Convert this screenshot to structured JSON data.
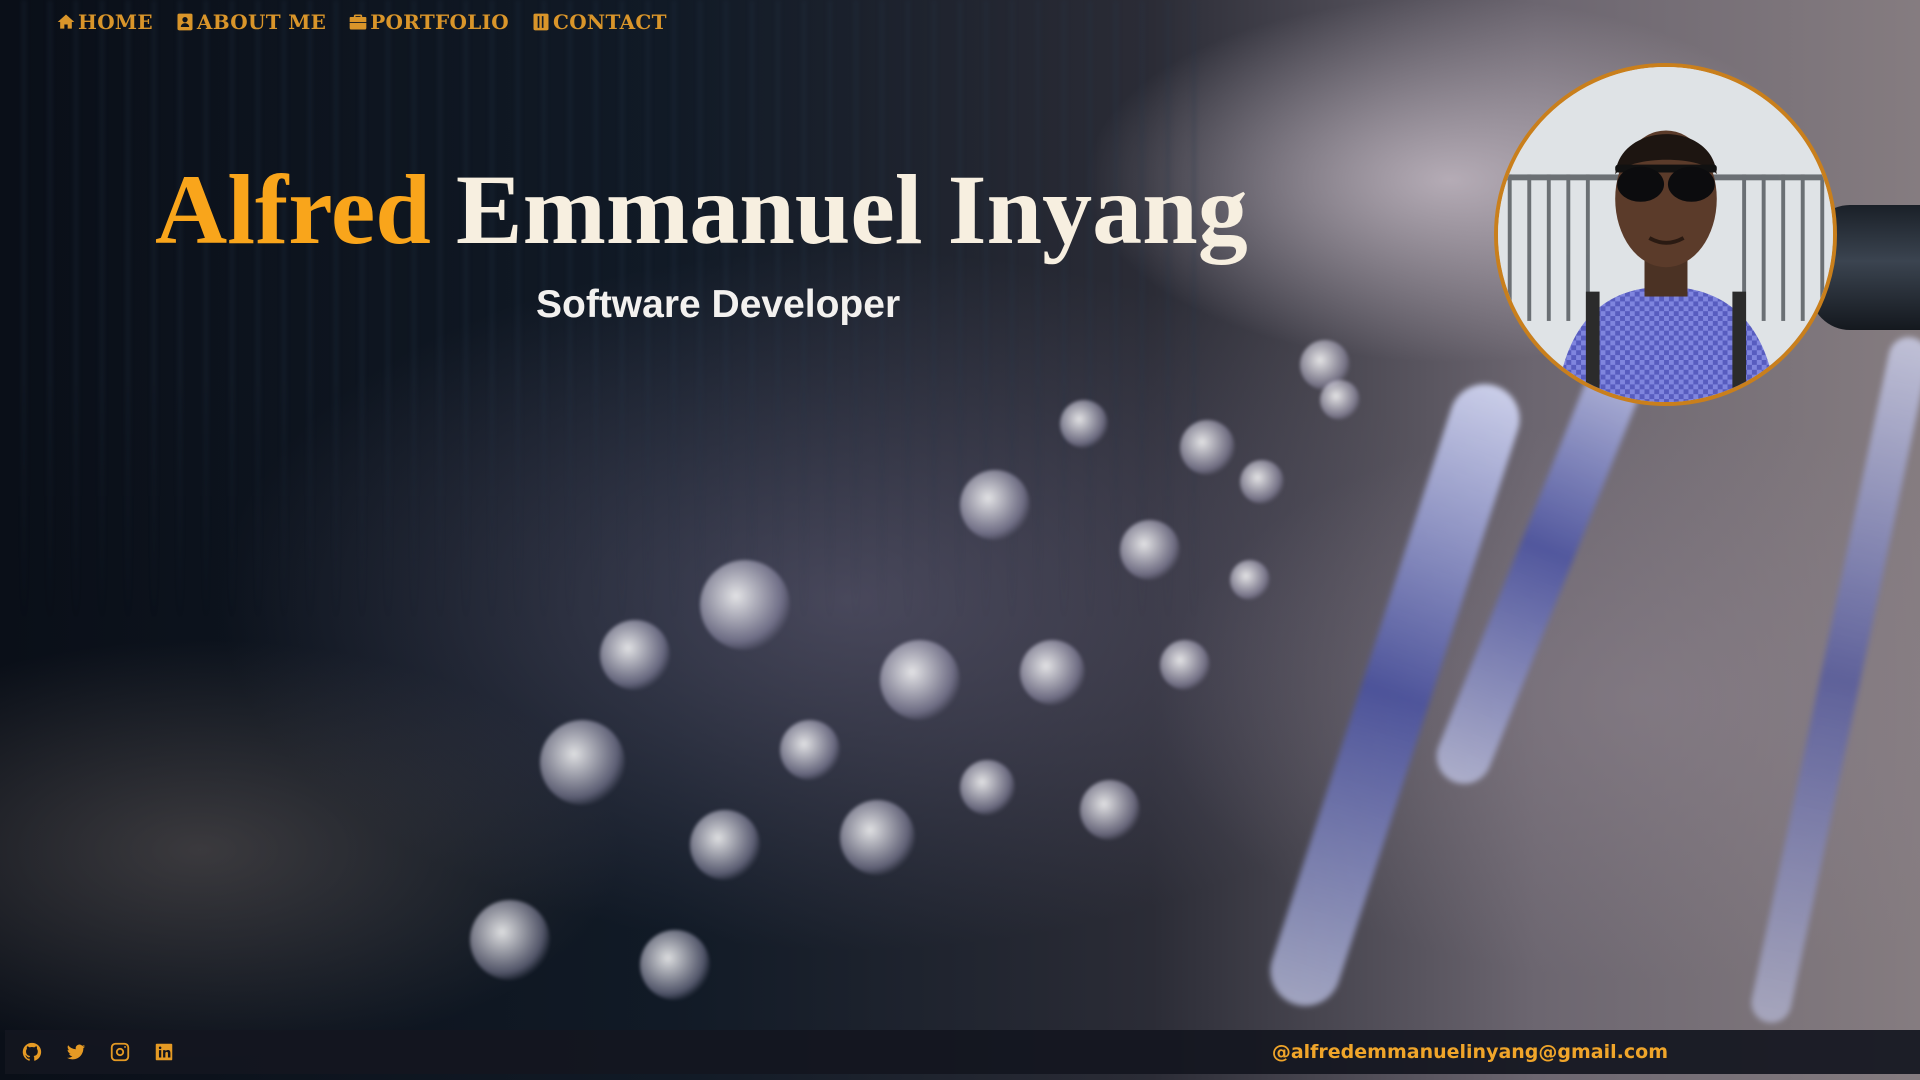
{
  "nav": {
    "items": [
      {
        "label": "HOME",
        "icon": "home-icon"
      },
      {
        "label": "ABOUT ME",
        "icon": "user-icon"
      },
      {
        "label": "PORTFOLIO",
        "icon": "briefcase-icon"
      },
      {
        "label": "CONTACT",
        "icon": "contact-book-icon"
      }
    ]
  },
  "hero": {
    "first_name": "Alfred",
    "rest_name": "Emmanuel Inyang",
    "subtitle": "Software Developer"
  },
  "profile_photo": {
    "icon": "profile-photo"
  },
  "footer": {
    "socials": [
      {
        "icon": "github-icon"
      },
      {
        "icon": "twitter-icon"
      },
      {
        "icon": "instagram-icon"
      },
      {
        "icon": "linkedin-icon"
      }
    ],
    "email": "@alfredemmanuelinyang@gmail.com"
  },
  "colors": {
    "accent": "#f9a51b",
    "nav": "#d9952a",
    "name_rest": "#f7efe0",
    "footer_bg": "#14161f"
  }
}
